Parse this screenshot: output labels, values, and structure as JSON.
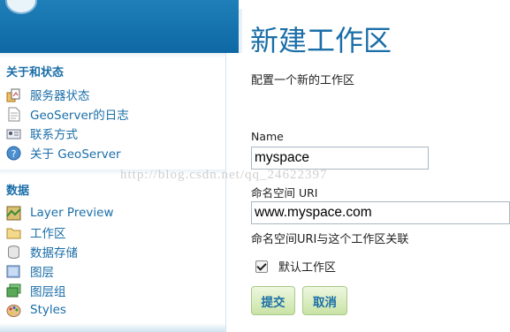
{
  "sidebar": {
    "about_section": {
      "title": "关于和状态",
      "items": [
        {
          "label": "服务器状态",
          "icon": "server-status-icon"
        },
        {
          "label": "GeoServer的日志",
          "icon": "log-document-icon"
        },
        {
          "label": "联系方式",
          "icon": "contact-card-icon"
        },
        {
          "label": "关于 GeoServer",
          "icon": "help-circle-icon"
        }
      ]
    },
    "data_section": {
      "title": "数据",
      "items": [
        {
          "label": "Layer Preview",
          "icon": "map-preview-icon"
        },
        {
          "label": "工作区",
          "icon": "folder-icon"
        },
        {
          "label": "数据存储",
          "icon": "database-icon"
        },
        {
          "label": "图层",
          "icon": "layer-icon"
        },
        {
          "label": "图层组",
          "icon": "layer-group-icon"
        },
        {
          "label": "Styles",
          "icon": "palette-icon"
        }
      ]
    }
  },
  "main": {
    "title": "新建工作区",
    "description": "配置一个新的工作区",
    "name_label": "Name",
    "name_value": "myspace",
    "uri_label": "命名空间 URI",
    "uri_value": "www.myspace.com",
    "uri_hint": "命名空间URI与这个工作区关联",
    "default_checkbox_label": "默认工作区",
    "default_checked": true,
    "submit_label": "提交",
    "cancel_label": "取消"
  },
  "watermark": "http://blog.csdn.net/qq_24622397",
  "colors": {
    "header_blue": "#0e68a4",
    "link_blue": "#1a6ea8",
    "button_green": "#c9e3a6"
  }
}
